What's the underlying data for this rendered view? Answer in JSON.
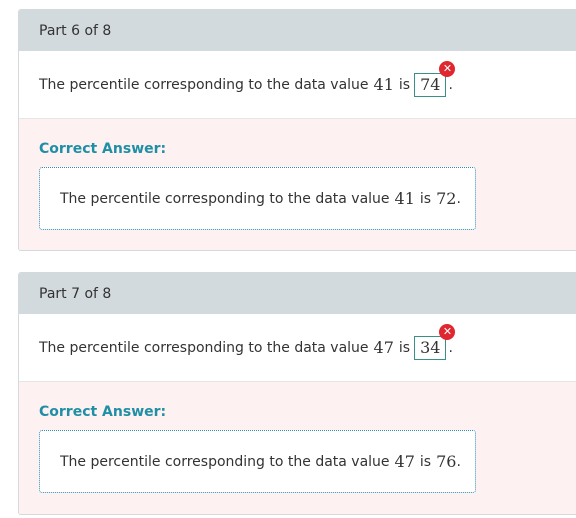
{
  "parts": [
    {
      "header": "Part 6 of 8",
      "question_prefix": "The percentile corresponding to the data value",
      "data_value": "41",
      "is_word": "is",
      "answer": "74",
      "period": ".",
      "error_glyph": "✕",
      "correct_label": "Correct Answer:",
      "correct_prefix": "The percentile corresponding to the data value",
      "correct_data_value": "41",
      "correct_is_word": "is",
      "correct_value": "72",
      "correct_period": "."
    },
    {
      "header": "Part 7 of 8",
      "question_prefix": "The percentile corresponding to the data value",
      "data_value": "47",
      "is_word": "is",
      "answer": "34",
      "period": ".",
      "error_glyph": "✕",
      "correct_label": "Correct Answer:",
      "correct_prefix": "The percentile corresponding to the data value",
      "correct_data_value": "47",
      "correct_is_word": "is",
      "correct_value": "76",
      "correct_period": "."
    }
  ],
  "colors": {
    "header_bg": "#d3dadd",
    "correct_bg": "#fdf1f1",
    "correct_label": "#1f8fa6",
    "error_red": "#e0262f",
    "answer_border": "#3a8f86"
  }
}
